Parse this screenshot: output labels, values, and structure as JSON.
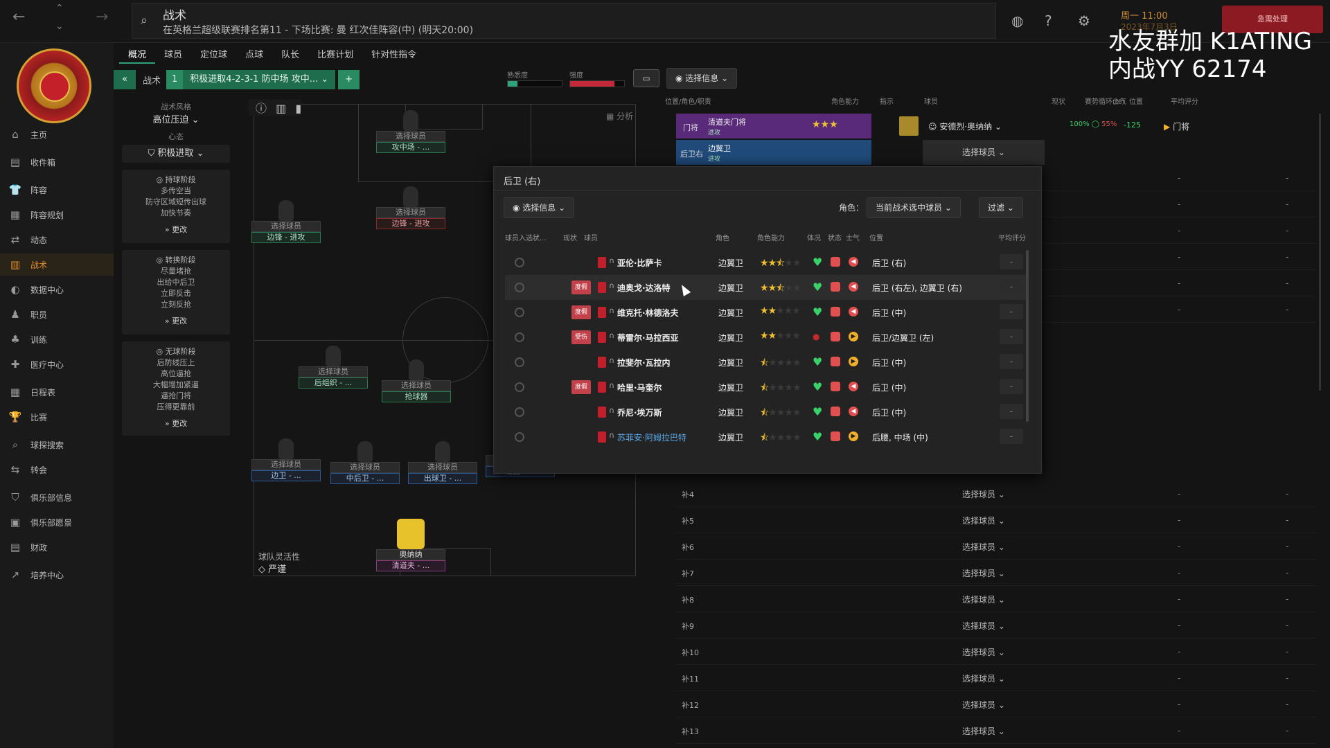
{
  "header": {
    "search_title": "战术",
    "search_sub": "在英格兰超级联赛排名第11 - 下场比赛: 曼 红次佳阵容(中) (明天20:00)",
    "date_line1": "周一 11:00",
    "date_line2": "2023年7月3日",
    "urgent_label": "急需处理",
    "watermark": "水友群加 K1ATING\n内战YY 62174"
  },
  "sidebar": {
    "items": [
      {
        "label": "主页",
        "icon": "home-icon"
      },
      {
        "label": "收件箱",
        "icon": "inbox-icon"
      },
      {
        "label": "阵容",
        "icon": "squad-icon"
      },
      {
        "label": "阵容规划",
        "icon": "planner-icon"
      },
      {
        "label": "动态",
        "icon": "dynamics-icon"
      },
      {
        "label": "战术",
        "icon": "tactics-icon"
      },
      {
        "label": "数据中心",
        "icon": "data-icon"
      },
      {
        "label": "职员",
        "icon": "staff-icon"
      },
      {
        "label": "训练",
        "icon": "training-icon"
      },
      {
        "label": "医疗中心",
        "icon": "medical-icon"
      },
      {
        "label": "日程表",
        "icon": "calendar-icon"
      },
      {
        "label": "比赛",
        "icon": "trophy-icon"
      },
      {
        "label": "球探搜索",
        "icon": "scouting-icon"
      },
      {
        "label": "转会",
        "icon": "transfer-icon"
      },
      {
        "label": "俱乐部信息",
        "icon": "club-info-icon"
      },
      {
        "label": "俱乐部愿景",
        "icon": "vision-icon"
      },
      {
        "label": "财政",
        "icon": "finance-icon"
      },
      {
        "label": "培养中心",
        "icon": "development-icon"
      }
    ]
  },
  "tabs": [
    "概况",
    "球员",
    "定位球",
    "点球",
    "队长",
    "比赛计划",
    "针对性指令"
  ],
  "tactic_bar": {
    "label": "战术",
    "number": "1",
    "name": "积极进取4-2-3-1 防中场 攻中...",
    "familiarity": "熟悉度",
    "intensity": "强度",
    "select_info": "选择信息"
  },
  "left_panel": {
    "style_label": "战术风格",
    "style_value": "高位压迫",
    "mentality_label": "心态",
    "mentality_value": "积极进取",
    "in_possession": {
      "title": "持球阶段",
      "lines": [
        "多传空当",
        "防守区域短传出球",
        "加快节奏"
      ],
      "change": "更改"
    },
    "transition": {
      "title": "转换阶段",
      "lines": [
        "尽量堵抢",
        "出给中后卫",
        "立即反击",
        "立刻反抢"
      ],
      "change": "更改"
    },
    "out_possession": {
      "title": "无球阶段",
      "lines": [
        "后防线压上",
        "高位逼抢",
        "大幅增加紧逼",
        "逼抢门将",
        "压得更靠前"
      ],
      "change": "更改"
    },
    "analysis": "分析",
    "flexibility_label": "球队灵活性",
    "flexibility_value": "严谨"
  },
  "pitch": {
    "select": "选择球员",
    "gk_name": "奥纳纳",
    "slots": [
      {
        "role": "边锋 - 进攻",
        "kind": "green"
      },
      {
        "role": "攻中场 - ...",
        "kind": "green"
      },
      {
        "role": "边锋 - 进攻",
        "kind": "red"
      },
      {
        "role": "后组织 - ...",
        "kind": "green"
      },
      {
        "role": "抢球器",
        "kind": "green"
      },
      {
        "role": "边卫 - ...",
        "kind": "blue"
      },
      {
        "role": "中后卫 - ...",
        "kind": "blue"
      },
      {
        "role": "出球卫 - ...",
        "kind": "blue"
      },
      {
        "role": "边卫 - ...",
        "kind": "blue"
      },
      {
        "role": "清道夫 - ...",
        "kind": "pink"
      }
    ]
  },
  "right": {
    "headers": [
      "位置/角色/职责",
      "角色能力",
      "指示",
      "球员",
      "现状",
      "赛势循环(%)",
      "士气",
      "位置",
      "平均评分"
    ],
    "gk": {
      "pos": "门将",
      "role": "清道夫门将",
      "duty": "进攻",
      "player": "安德烈·奥纳纳",
      "pct1": "100%",
      "pct2": "55%",
      "delta": "-125",
      "position": "门将"
    },
    "cb": {
      "pos": "后卫右",
      "role": "边翼卫",
      "duty": "进攻",
      "player": "选择球员"
    },
    "subs": [
      "补4",
      "补5",
      "补6",
      "补7",
      "补8",
      "补9",
      "补10",
      "补11",
      "补12",
      "补13"
    ],
    "select": "选择球员",
    "dash": "-"
  },
  "popup": {
    "title": "后卫 (右)",
    "select_info": "选择信息",
    "role_label": "角色：",
    "role_filter": "当前战术选中球员",
    "filter": "过滤",
    "columns": [
      "球员入选状...",
      "现状",
      "球员",
      "角色",
      "角色能力",
      "体况",
      "状态",
      "士气",
      "位置",
      "平均评分"
    ],
    "players": [
      {
        "name": "亚伦·比萨卡",
        "badge": "",
        "role": "边翼卫",
        "stars": 2.5,
        "fit": "good",
        "mood": "red",
        "pos": "后卫 (右)",
        "avg": "-"
      },
      {
        "name": "迪奥戈·达洛特",
        "badge": "度假",
        "role": "边翼卫",
        "stars": 2.5,
        "fit": "good",
        "mood": "red",
        "pos": "后卫 (右左), 边翼卫 (右)",
        "avg": "-"
      },
      {
        "name": "维克托·林德洛夫",
        "badge": "度假",
        "role": "边翼卫",
        "stars": 2,
        "fit": "good",
        "mood": "red",
        "pos": "后卫 (中)",
        "avg": "-"
      },
      {
        "name": "蒂雷尔·马拉西亚",
        "badge": "受伤",
        "role": "边翼卫",
        "stars": 2,
        "fit": "bad",
        "mood": "yellow",
        "pos": "后卫/边翼卫 (左)",
        "avg": "-"
      },
      {
        "name": "拉斐尔·瓦拉内",
        "badge": "",
        "role": "边翼卫",
        "stars": 0.5,
        "fit": "good",
        "mood": "yellow",
        "pos": "后卫 (中)",
        "avg": "-"
      },
      {
        "name": "哈里·马奎尔",
        "badge": "度假",
        "role": "边翼卫",
        "stars": 0.5,
        "fit": "good",
        "mood": "red",
        "pos": "后卫 (中)",
        "avg": "-"
      },
      {
        "name": "乔尼·埃万斯",
        "badge": "",
        "role": "边翼卫",
        "stars": 0.5,
        "fit": "good",
        "mood": "red",
        "pos": "后卫 (中)",
        "avg": "-"
      },
      {
        "name": "苏菲安·阿姆拉巴特",
        "badge": "",
        "role": "边翼卫",
        "stars": 0.5,
        "fit": "good",
        "mood": "yellow",
        "pos": "后腰, 中场 (中)",
        "avg": "-",
        "blue": true
      }
    ]
  },
  "colors": {
    "accent": "#2fa27a",
    "brand_red": "#c21f2d",
    "urgent": "#8c1a22",
    "gk_purple": "#5a2a7a",
    "def_blue": "#1f4a7a"
  }
}
